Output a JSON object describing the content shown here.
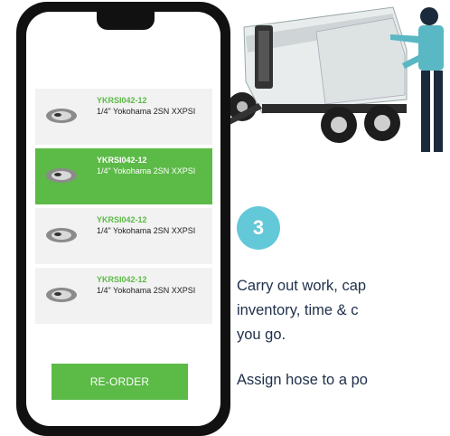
{
  "list": {
    "items": [
      {
        "code": "YKRSI042-12",
        "desc": "1/4\" Yokohama 2SN XXPSI",
        "selected": false
      },
      {
        "code": "YKRSI042-12",
        "desc": "1/4\" Yokohama 2SN XXPSI",
        "selected": true
      },
      {
        "code": "YKRSI042-12",
        "desc": "1/4\" Yokohama 2SN XXPSI",
        "selected": false
      },
      {
        "code": "YKRSI042-12",
        "desc": "1/4\" Yokohama 2SN XXPSI",
        "selected": false
      }
    ],
    "reorder_label": "RE-ORDER"
  },
  "step": {
    "number": "3",
    "line1": "Carry out work, cap",
    "line2": "inventory, time & c",
    "line3": "you go.",
    "line4": "Assign hose to a po"
  },
  "colors": {
    "accent": "#5cba47",
    "badge": "#63c8d8",
    "text": "#1f2f4a"
  },
  "icons": [
    "hose-fitting-thumbnail-icon",
    "service-trailer-illustration",
    "technician-illustration"
  ]
}
